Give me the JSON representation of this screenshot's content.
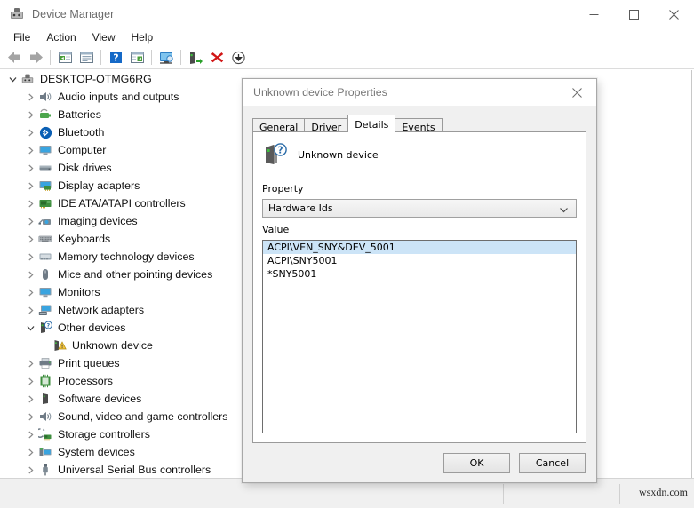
{
  "window": {
    "title": "Device Manager",
    "icon": "device-manager-icon",
    "controls": {
      "minimize": "minimize-icon",
      "maximize": "maximize-icon",
      "close": "close-icon"
    }
  },
  "menubar": {
    "items": [
      {
        "label": "File"
      },
      {
        "label": "Action"
      },
      {
        "label": "View"
      },
      {
        "label": "Help"
      }
    ]
  },
  "toolbar": {
    "buttons": [
      {
        "name": "back-icon"
      },
      {
        "name": "forward-icon"
      },
      {
        "name": "separator"
      },
      {
        "name": "properties-icon"
      },
      {
        "name": "show-hide-console-tree-icon"
      },
      {
        "name": "separator"
      },
      {
        "name": "help-icon"
      },
      {
        "name": "scan-for-hardware-changes-icon"
      },
      {
        "name": "separator"
      },
      {
        "name": "update-driver-icon"
      },
      {
        "name": "separator"
      },
      {
        "name": "enable-device-icon"
      },
      {
        "name": "uninstall-device-icon"
      },
      {
        "name": "disable-device-icon"
      }
    ]
  },
  "tree": {
    "root": {
      "label": "DESKTOP-OTMG6RG",
      "icon": "computer-node-icon",
      "expanded": true,
      "indent": 0
    },
    "items": [
      {
        "label": "Audio inputs and outputs",
        "icon": "speaker-icon",
        "expanded": false,
        "indent": 1
      },
      {
        "label": "Batteries",
        "icon": "battery-icon",
        "expanded": false,
        "indent": 1
      },
      {
        "label": "Bluetooth",
        "icon": "bluetooth-icon",
        "expanded": false,
        "indent": 1
      },
      {
        "label": "Computer",
        "icon": "monitor-icon",
        "expanded": false,
        "indent": 1
      },
      {
        "label": "Disk drives",
        "icon": "disk-drive-icon",
        "expanded": false,
        "indent": 1
      },
      {
        "label": "Display adapters",
        "icon": "display-adapter-icon",
        "expanded": false,
        "indent": 1
      },
      {
        "label": "IDE ATA/ATAPI controllers",
        "icon": "ide-controller-icon",
        "expanded": false,
        "indent": 1
      },
      {
        "label": "Imaging devices",
        "icon": "imaging-device-icon",
        "expanded": false,
        "indent": 1
      },
      {
        "label": "Keyboards",
        "icon": "keyboard-icon",
        "expanded": false,
        "indent": 1
      },
      {
        "label": "Memory technology devices",
        "icon": "memory-device-icon",
        "expanded": false,
        "indent": 1
      },
      {
        "label": "Mice and other pointing devices",
        "icon": "mouse-icon",
        "expanded": false,
        "indent": 1
      },
      {
        "label": "Monitors",
        "icon": "monitor-icon",
        "expanded": false,
        "indent": 1
      },
      {
        "label": "Network adapters",
        "icon": "network-adapter-icon",
        "expanded": false,
        "indent": 1
      },
      {
        "label": "Other devices",
        "icon": "other-devices-icon",
        "expanded": true,
        "indent": 1
      },
      {
        "label": "Unknown device",
        "icon": "unknown-device-warning-icon",
        "expanded": null,
        "indent": 2
      },
      {
        "label": "Print queues",
        "icon": "printer-icon",
        "expanded": false,
        "indent": 1
      },
      {
        "label": "Processors",
        "icon": "processor-icon",
        "expanded": false,
        "indent": 1
      },
      {
        "label": "Software devices",
        "icon": "software-device-icon",
        "expanded": false,
        "indent": 1
      },
      {
        "label": "Sound, video and game controllers",
        "icon": "sound-controller-icon",
        "expanded": false,
        "indent": 1
      },
      {
        "label": "Storage controllers",
        "icon": "storage-controller-icon",
        "expanded": false,
        "indent": 1
      },
      {
        "label": "System devices",
        "icon": "system-device-icon",
        "expanded": false,
        "indent": 1
      },
      {
        "label": "Universal Serial Bus controllers",
        "icon": "usb-controller-icon",
        "expanded": false,
        "indent": 1
      }
    ]
  },
  "dialog": {
    "title": "Unknown device Properties",
    "close_icon": "close-icon",
    "tabs": [
      {
        "label": "General",
        "active": false
      },
      {
        "label": "Driver",
        "active": false
      },
      {
        "label": "Details",
        "active": true
      },
      {
        "label": "Events",
        "active": false
      }
    ],
    "device": {
      "name": "Unknown device",
      "icon": "unknown-device-question-icon"
    },
    "property": {
      "label": "Property",
      "selected": "Hardware Ids",
      "arrow_icon": "chevron-down-icon"
    },
    "value": {
      "label": "Value",
      "rows": [
        {
          "text": "ACPI\\VEN_SNY&DEV_5001",
          "selected": true
        },
        {
          "text": "ACPI\\SNY5001",
          "selected": false
        },
        {
          "text": "*SNY5001",
          "selected": false
        }
      ]
    },
    "buttons": {
      "ok": "OK",
      "cancel": "Cancel"
    }
  },
  "statusbar": {
    "left_text": "",
    "middle_text": ""
  },
  "watermark": {
    "text": "wsxdn.com"
  },
  "colors": {
    "selection_blue": "#cce4f7",
    "warning_yellow": "#f2c43d",
    "accent_green": "#2aa02a",
    "error_red": "#d11717",
    "title_gray": "#777777"
  }
}
